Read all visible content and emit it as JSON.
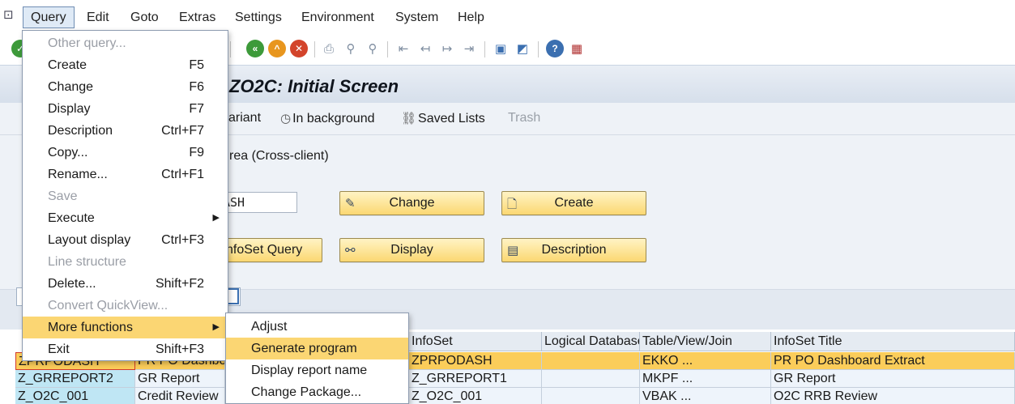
{
  "menubar": {
    "items": [
      "Query",
      "Edit",
      "Goto",
      "Extras",
      "Settings",
      "Environment",
      "System",
      "Help"
    ]
  },
  "title": "ZO2C: Initial Screen",
  "app_toolbar": {
    "variant_fragment": "ariant",
    "in_background": "In background",
    "saved_lists": "Saved Lists",
    "trash": "Trash"
  },
  "body": {
    "area_fragment": "rea (Cross-client)",
    "query_value": "ASH",
    "change_button": "Change",
    "create_button": "Create",
    "infoset_query_button_fragment": "nfoSet Query",
    "display_button": "Display",
    "description_button": "Description"
  },
  "query_menu": {
    "items": [
      {
        "label": "Other query...",
        "shortcut": "",
        "disabled": true
      },
      {
        "label": "Create",
        "shortcut": "F5"
      },
      {
        "label": "Change",
        "shortcut": "F6"
      },
      {
        "label": "Display",
        "shortcut": "F7"
      },
      {
        "label": "Description",
        "shortcut": "Ctrl+F7"
      },
      {
        "label": "Copy...",
        "shortcut": "F9"
      },
      {
        "label": "Rename...",
        "shortcut": "Ctrl+F1"
      },
      {
        "label": "Save",
        "shortcut": "",
        "disabled": true
      },
      {
        "label": "Execute",
        "shortcut": "",
        "submenu": true
      },
      {
        "label": "Layout display",
        "shortcut": "Ctrl+F3"
      },
      {
        "label": "Line structure",
        "shortcut": "",
        "disabled": true
      },
      {
        "label": "Delete...",
        "shortcut": "Shift+F2"
      },
      {
        "label": "Convert QuickView...",
        "shortcut": "",
        "disabled": true
      },
      {
        "label": "More functions",
        "shortcut": "",
        "submenu": true,
        "highlighted": true
      },
      {
        "label": "Exit",
        "shortcut": "Shift+F3"
      }
    ]
  },
  "more_functions_menu": {
    "items": [
      {
        "label": "Adjust"
      },
      {
        "label": "Generate program",
        "highlighted": true
      },
      {
        "label": "Display report name"
      },
      {
        "label": "Change Package..."
      }
    ]
  },
  "table": {
    "columns": [
      "InfoSet",
      "Logical Database",
      "Table/View/Join",
      "InfoSet Title"
    ],
    "rows": [
      {
        "query": "ZPRPODASH",
        "title": "PR PO Dashboa",
        "infoset": "ZPRPODASH",
        "ldb": "",
        "table": "EKKO ...",
        "infoset_title": "PR PO Dashboard Extract",
        "selected": true
      },
      {
        "query": "Z_GRREPORT2",
        "title": "GR Report",
        "infoset": "Z_GRREPORT1",
        "ldb": "",
        "table": "MKPF ...",
        "infoset_title": "GR Report"
      },
      {
        "query": "Z_O2C_001",
        "title": "Credit Review",
        "infoset": "Z_O2C_001",
        "ldb": "",
        "table": "VBAK ...",
        "infoset_title": "O2C RRB Review"
      }
    ]
  },
  "colors": {
    "highlight": "#fbd673",
    "button": "#fbd872",
    "selected_row": "#fbcd5a",
    "key_cell": "#bfe6f4"
  }
}
